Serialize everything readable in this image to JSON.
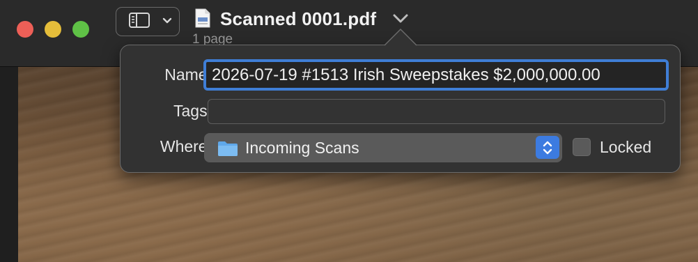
{
  "window": {
    "title": "Scanned 0001.pdf",
    "subtitle": "1 page"
  },
  "icons": {
    "close": "close-button",
    "minimize": "minimize-button",
    "zoom": "zoom-button",
    "sidebar": "sidebar-icon",
    "chevron": "chevron-down-icon",
    "document": "pdf-document-icon",
    "folder": "folder-icon",
    "stepper": "up-down-chevron-icon"
  },
  "popover": {
    "name_label": "Name:",
    "name_value": "2026-07-19 #1513 Irish Sweepstakes $2,000,000.00",
    "tags_label": "Tags:",
    "tags_value": "",
    "where_label": "Where:",
    "where_value": "Incoming Scans",
    "locked_label": "Locked",
    "locked_checked": false
  },
  "colors": {
    "accent": "#3f7ed6",
    "close": "#ed5f57",
    "minimize": "#e5bd3a",
    "zoom": "#5fc146"
  }
}
